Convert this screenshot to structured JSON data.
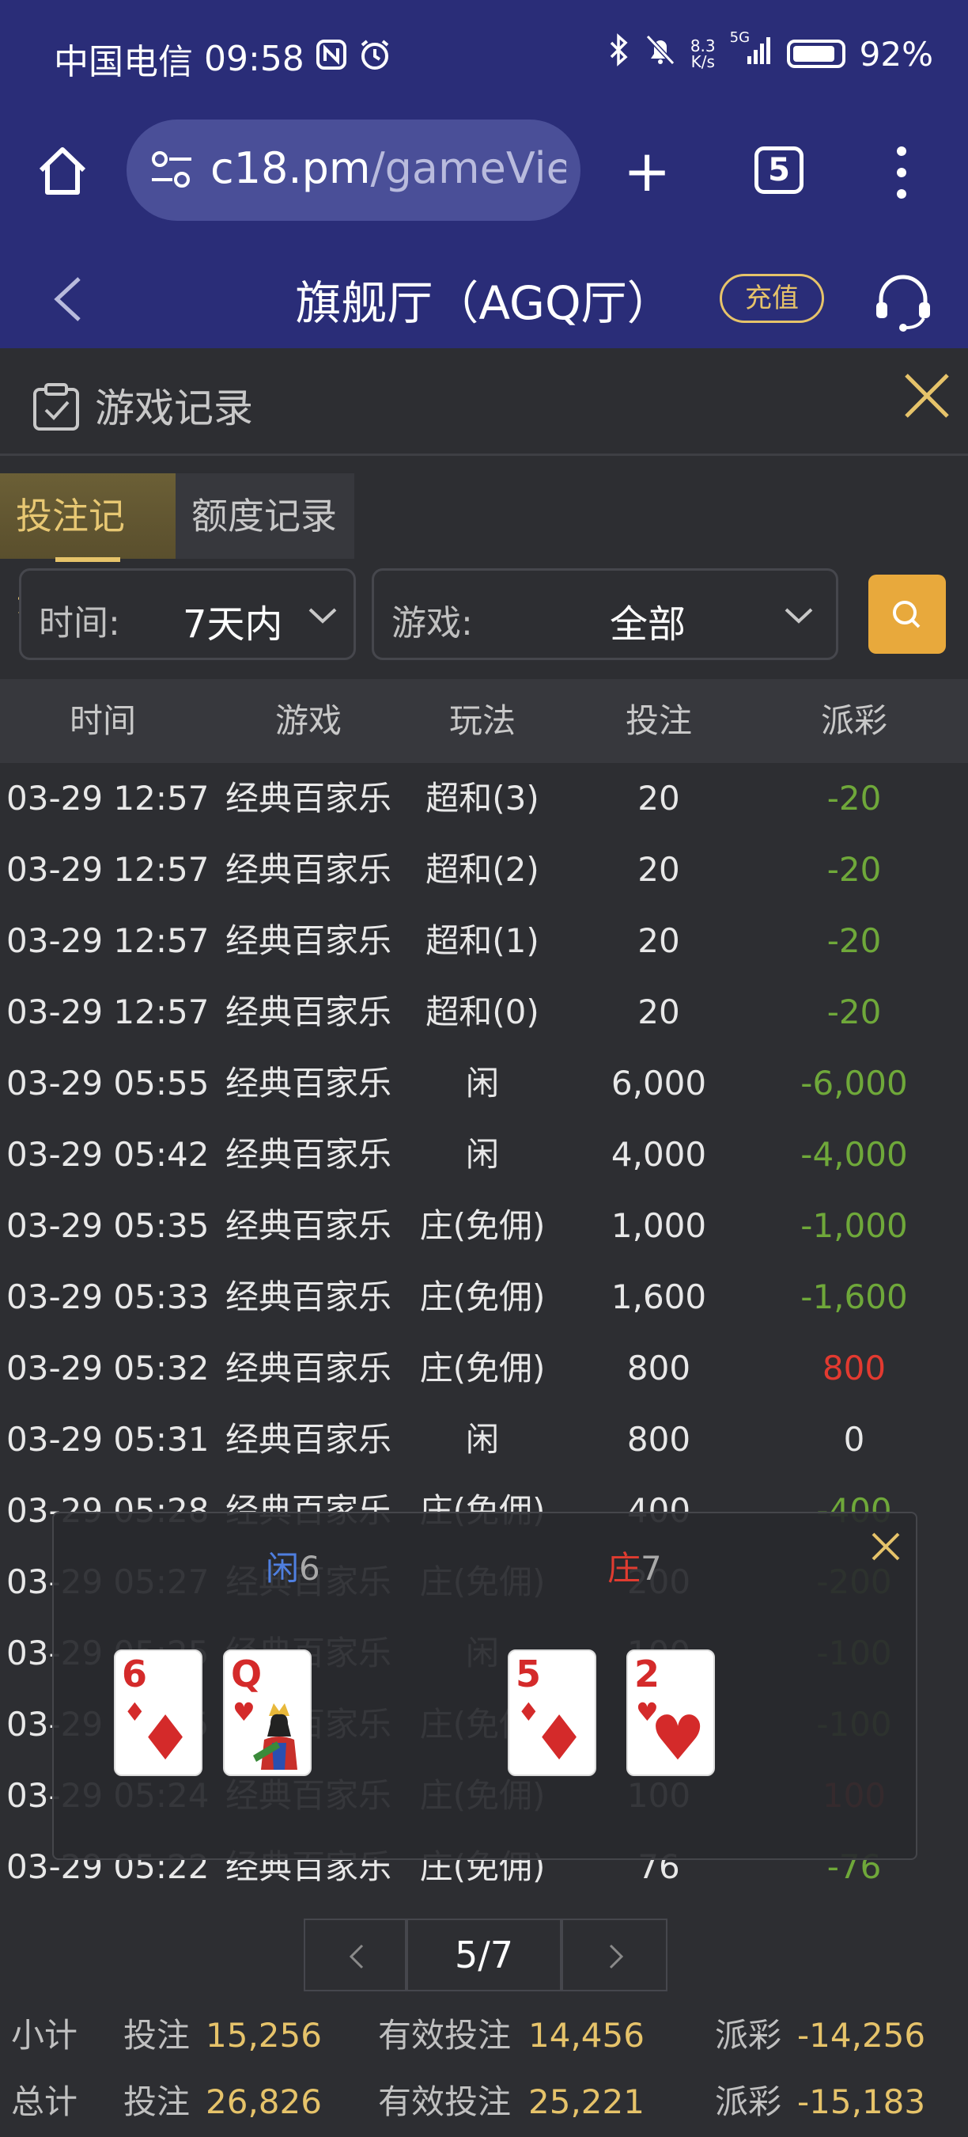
{
  "status_bar": {
    "carrier": "中国电信",
    "time": "09:58",
    "net_speed_top": "8.3",
    "net_speed_bottom": "K/s",
    "signal_label": "5G",
    "battery": "92%",
    "battery_level": 0.92
  },
  "browser": {
    "url_host": "c18.pm",
    "url_path": "/gameView?",
    "tab_count": "5"
  },
  "app_header": {
    "title": "旗舰厅（AGQ厅）",
    "recharge_label": "充值"
  },
  "panel": {
    "title": "游戏记录",
    "tabs": [
      {
        "label": "投注记录",
        "active": true
      },
      {
        "label": "额度记录",
        "active": false
      }
    ],
    "filters": {
      "time_label": "时间:",
      "time_value": "7天内",
      "game_label": "游戏:",
      "game_value": "全部"
    },
    "columns": [
      "时间",
      "游戏",
      "玩法",
      "投注",
      "派彩"
    ],
    "rows": [
      {
        "time": "03-29 12:57",
        "game": "经典百家乐",
        "play": "超和(3)",
        "bet": "20",
        "payout": "-20",
        "sign": "neg"
      },
      {
        "time": "03-29 12:57",
        "game": "经典百家乐",
        "play": "超和(2)",
        "bet": "20",
        "payout": "-20",
        "sign": "neg"
      },
      {
        "time": "03-29 12:57",
        "game": "经典百家乐",
        "play": "超和(1)",
        "bet": "20",
        "payout": "-20",
        "sign": "neg"
      },
      {
        "time": "03-29 12:57",
        "game": "经典百家乐",
        "play": "超和(0)",
        "bet": "20",
        "payout": "-20",
        "sign": "neg"
      },
      {
        "time": "03-29 05:55",
        "game": "经典百家乐",
        "play": "闲",
        "bet": "6,000",
        "payout": "-6,000",
        "sign": "neg"
      },
      {
        "time": "03-29 05:42",
        "game": "经典百家乐",
        "play": "闲",
        "bet": "4,000",
        "payout": "-4,000",
        "sign": "neg"
      },
      {
        "time": "03-29 05:35",
        "game": "经典百家乐",
        "play": "庄(免佣)",
        "bet": "1,000",
        "payout": "-1,000",
        "sign": "neg"
      },
      {
        "time": "03-29 05:33",
        "game": "经典百家乐",
        "play": "庄(免佣)",
        "bet": "1,600",
        "payout": "-1,600",
        "sign": "neg"
      },
      {
        "time": "03-29 05:32",
        "game": "经典百家乐",
        "play": "庄(免佣)",
        "bet": "800",
        "payout": "800",
        "sign": "pos"
      },
      {
        "time": "03-29 05:31",
        "game": "经典百家乐",
        "play": "闲",
        "bet": "800",
        "payout": "0",
        "sign": "zero"
      },
      {
        "time": "03-29 05:28",
        "game": "经典百家乐",
        "play": "庄(免佣)",
        "bet": "400",
        "payout": "-400",
        "sign": "neg"
      },
      {
        "time": "03-29 05:27",
        "game": "经典百家乐",
        "play": "庄(免佣)",
        "bet": "200",
        "payout": "-200",
        "sign": "neg"
      },
      {
        "time": "03-29 05:25",
        "game": "经典百家乐",
        "play": "闲",
        "bet": "100",
        "payout": "-100",
        "sign": "neg"
      },
      {
        "time": "03-29 05:25",
        "game": "经典百家乐",
        "play": "庄(免佣)",
        "bet": "100",
        "payout": "-100",
        "sign": "neg"
      },
      {
        "time": "03-29 05:24",
        "game": "经典百家乐",
        "play": "庄(免佣)",
        "bet": "100",
        "payout": "100",
        "sign": "pos"
      },
      {
        "time": "03-29 05:22",
        "game": "经典百家乐",
        "play": "庄(免佣)",
        "bet": "76",
        "payout": "-76",
        "sign": "neg"
      }
    ],
    "popup": {
      "player_label": "闲",
      "player_score": "6",
      "banker_label": "庄",
      "banker_score": "7",
      "player_cards": [
        {
          "rank": "6",
          "suit": "♦"
        },
        {
          "rank": "Q",
          "suit": "♥"
        }
      ],
      "banker_cards": [
        {
          "rank": "5",
          "suit": "♦"
        },
        {
          "rank": "2",
          "suit": "♥"
        }
      ]
    },
    "pagination": {
      "current": "5/7"
    },
    "summary": {
      "subtotal_label": "小计",
      "total_label": "总计",
      "bet_label": "投注",
      "valid_bet_label": "有效投注",
      "payout_label": "派彩",
      "subtotal": {
        "bet": "15,256",
        "valid_bet": "14,456",
        "payout": "-14,256"
      },
      "total": {
        "bet": "26,826",
        "valid_bet": "25,221",
        "payout": "-15,183"
      }
    }
  },
  "colors": {
    "header_bg": "#2a2d78",
    "accent_gold": "#e6c36a",
    "negative_green": "#6fa83a",
    "positive_red": "#e23a30",
    "player_blue": "#4f7fe0"
  }
}
